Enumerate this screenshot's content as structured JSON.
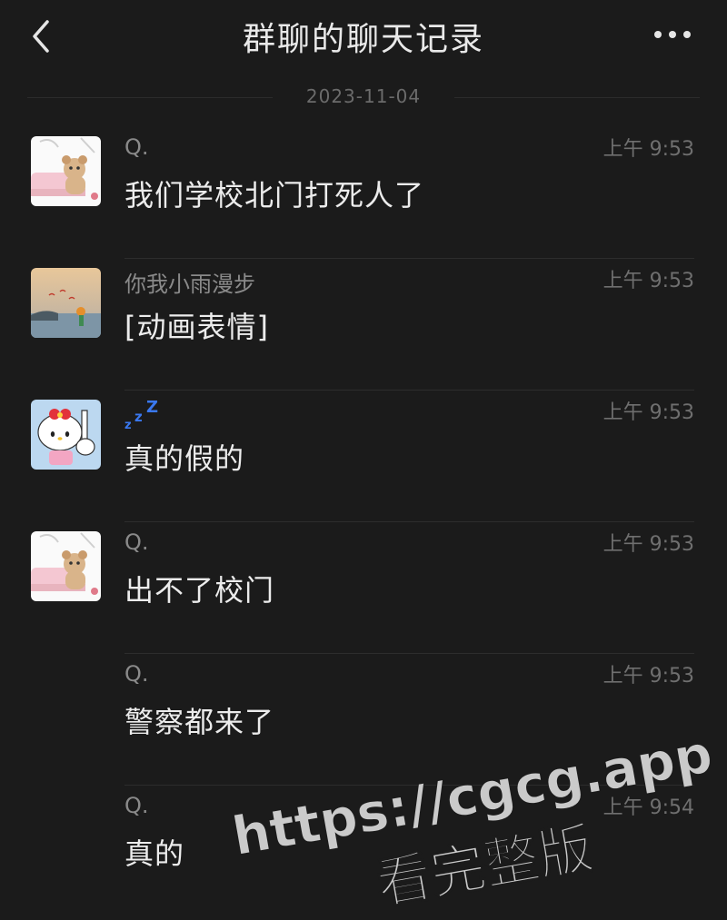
{
  "header": {
    "title": "群聊的聊天记录",
    "back_icon": "chevron-left-icon",
    "more_icon": "more-dots-icon"
  },
  "date_separator": "2023-11-04",
  "messages": [
    {
      "sender": "Q.",
      "time": "上午 9:53",
      "text": "我们学校北门打死人了",
      "avatar": "hello-kitty-bear-avatar"
    },
    {
      "sender": "你我小雨漫步",
      "time": "上午 9:53",
      "text": "[动画表情]",
      "avatar": "seaside-scenery-avatar"
    },
    {
      "sender": "zzz",
      "time": "上午 9:53",
      "text": "真的假的",
      "avatar": "hello-kitty-pointing-avatar"
    },
    {
      "sender": "Q.",
      "time": "上午 9:53",
      "text": "出不了校门",
      "avatar": "hello-kitty-bear-avatar"
    },
    {
      "sender": "Q.",
      "time": "上午 9:53",
      "text": "警察都来了"
    },
    {
      "sender": "Q.",
      "time": "上午 9:54",
      "text": "真的"
    }
  ],
  "watermark": {
    "line1": "https://cgcg.app",
    "line2": "看完整版"
  },
  "colors": {
    "background": "#1b1b1b",
    "sleep_icon": "#3a78f0",
    "watermark": "#d9d9d9"
  }
}
